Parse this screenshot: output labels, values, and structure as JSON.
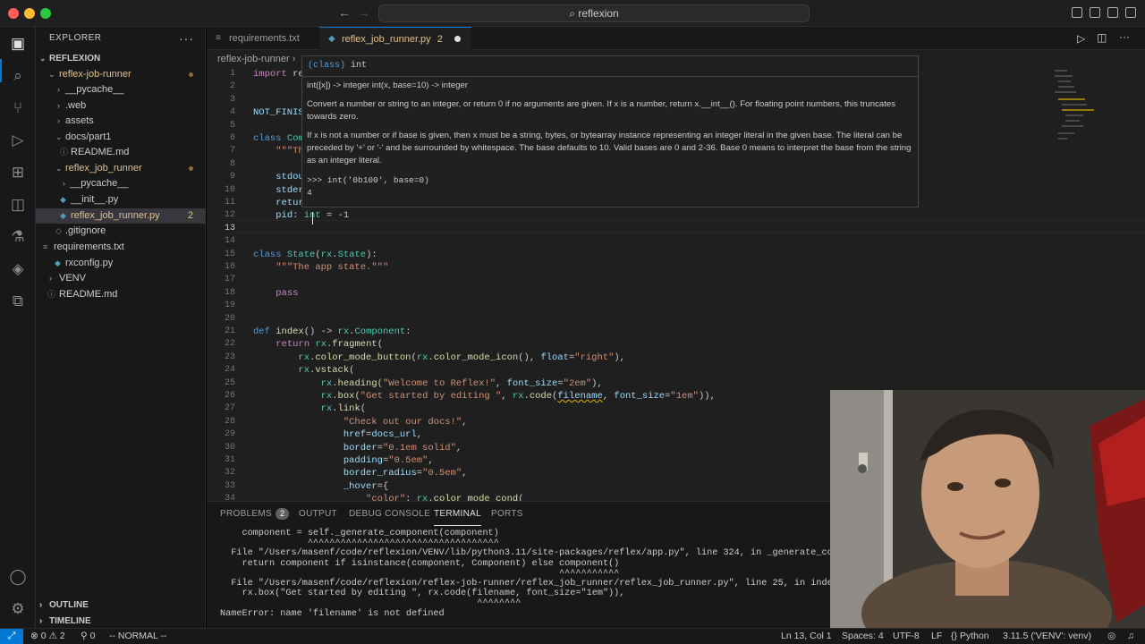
{
  "window": {
    "search_text": "reflexion"
  },
  "colors": {
    "accent": "#0078d4",
    "modified": "#e2c08d",
    "background": "#1f1f1f"
  },
  "sidebar": {
    "header": "EXPLORER",
    "root": "REFLEXION",
    "items": [
      {
        "label": "reflex-job-runner",
        "type": "folder-open",
        "modified": true
      },
      {
        "label": "__pycache__",
        "type": "folder"
      },
      {
        "label": ".web",
        "type": "folder"
      },
      {
        "label": "assets",
        "type": "folder"
      },
      {
        "label": "docs/part1",
        "type": "folder-open"
      },
      {
        "label": "README.md",
        "type": "markdown"
      },
      {
        "label": "reflex_job_runner",
        "type": "folder-open",
        "modified": true
      },
      {
        "label": "__pycache__",
        "type": "folder"
      },
      {
        "label": "__init__.py",
        "type": "python"
      },
      {
        "label": "reflex_job_runner.py",
        "type": "python",
        "modified": true,
        "count": "2",
        "selected": true
      },
      {
        "label": ".gitignore",
        "type": "file"
      },
      {
        "label": "requirements.txt",
        "type": "file"
      },
      {
        "label": "rxconfig.py",
        "type": "python"
      },
      {
        "label": "VENV",
        "type": "folder"
      },
      {
        "label": "README.md",
        "type": "markdown"
      }
    ],
    "outline": "OUTLINE",
    "timeline": "TIMELINE"
  },
  "tabs": [
    {
      "label": "requirements.txt"
    },
    {
      "label": "reflex_job_runner.py",
      "count": "2"
    }
  ],
  "breadcrumb": "reflex-job-runner",
  "editor": {
    "line_numbers": [
      "1",
      "2",
      "3",
      "4",
      "5",
      "6",
      "7",
      "8",
      "9",
      "10",
      "11",
      "12",
      "13",
      "14",
      "15",
      "16",
      "17",
      "18",
      "19",
      "20",
      "21",
      "22",
      "23",
      "24",
      "25",
      "26",
      "27",
      "28",
      "29",
      "30",
      "31",
      "32",
      "33",
      "34"
    ],
    "current_line": "13"
  },
  "hover": {
    "signature_kw": "(class)",
    "signature_name": "int",
    "sig2": "int([x]) -> integer int(x, base=10) -> integer",
    "p1": "Convert a number or string to an integer, or return 0 if no arguments are given. If x is a number, return x.__int__(). For floating point numbers, this truncates towards zero.",
    "p2": "If x is not a number or if base is given, then x must be a string, bytes, or bytearray instance representing an integer literal in the given base. The literal can be preceded by '+' or '-' and be surrounded by whitespace. The base defaults to 10. Valid bases are 0 and 2-36. Base 0 means to interpret the base from the string as an integer literal.",
    "example": ">>> int('0b100', base=0)",
    "result": "4"
  },
  "panel": {
    "tabs": [
      "PROBLEMS",
      "OUTPUT",
      "DEBUG CONSOLE",
      "TERMINAL",
      "PORTS"
    ],
    "problems_count": "2",
    "active_tab": "TERMINAL",
    "terminal_lines": [
      "    component = self._generate_component(component)",
      "                ^^^^^^^^^^^^^^^^^^^^^^^^^^^^^^^^^^^",
      "  File \"/Users/masenf/code/reflexion/VENV/lib/python3.11/site-packages/reflex/app.py\", line 324, in _generate_component",
      "    return component if isinstance(component, Component) else component()",
      "                                                              ^^^^^^^^^^^",
      "  File \"/Users/masenf/code/reflexion/reflex-job-runner/reflex_job_runner/reflex_job_runner.py\", line 25, in index",
      "    rx.box(\"Get started by editing \", rx.code(filename, font_size=\"1em\")),",
      "                                               ^^^^^^^^",
      "NameError: name 'filename' is not defined",
      ""
    ]
  },
  "status": {
    "errors": "0",
    "warnings": "2",
    "ports": "0",
    "mode": "-- NORMAL --",
    "position": "Ln 13, Col 1",
    "spaces": "Spaces: 4",
    "encoding": "UTF-8",
    "eol": "LF",
    "language": "Python",
    "interpreter": "3.11.5 ('VENV': venv)"
  }
}
